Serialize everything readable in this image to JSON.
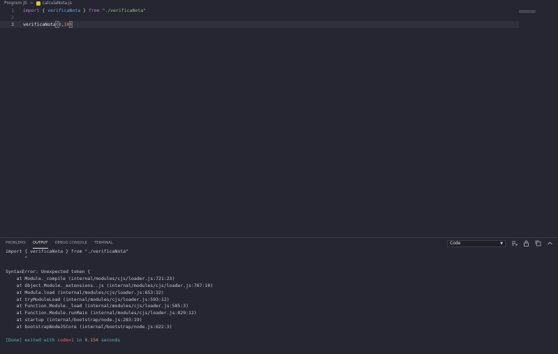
{
  "breadcrumb": {
    "folder": "Program JS",
    "separator": ">",
    "file": "calculaNota.js"
  },
  "editor": {
    "lines": [
      {
        "number": "1",
        "tokens": [
          {
            "cls": "kw",
            "text": "import"
          },
          {
            "cls": "pun",
            "text": " { "
          },
          {
            "cls": "var",
            "text": "verificaNota"
          },
          {
            "cls": "pun",
            "text": " } "
          },
          {
            "cls": "kw",
            "text": "from"
          },
          {
            "cls": "pun",
            "text": " "
          },
          {
            "cls": "str",
            "text": "\"./verificaNota\""
          }
        ]
      },
      {
        "number": "2",
        "tokens": []
      },
      {
        "number": "3",
        "tokens": [
          {
            "cls": "fn",
            "text": "verificaNota"
          },
          {
            "cls": "brk",
            "text": "("
          },
          {
            "cls": "num",
            "text": "8"
          },
          {
            "cls": "pun",
            "text": ","
          },
          {
            "cls": "num",
            "text": "10"
          },
          {
            "cls": "brk",
            "text": ")"
          }
        ]
      }
    ]
  },
  "panel": {
    "tabs": [
      "PROBLEMS",
      "OUTPUT",
      "DEBUG CONSOLE",
      "TERMINAL"
    ],
    "active_tab": "OUTPUT",
    "dropdown_value": "Code",
    "icons": [
      "clear-output-icon",
      "lock-icon",
      "copy-icon",
      "close-panel-icon"
    ],
    "output_lines": [
      "import { verificaNota } from \"./verificaNota\"",
      "       ^",
      "",
      "SyntaxError: Unexpected token {",
      "    at Module._compile (internal/modules/cjs/loader.js:721:23)",
      "    at Object.Module._extensions..js (internal/modules/cjs/loader.js:787:10)",
      "    at Module.load (internal/modules/cjs/loader.js:653:32)",
      "    at tryModuleLoad (internal/modules/cjs/loader.js:593:12)",
      "    at Function.Module._load (internal/modules/cjs/loader.js:585:3)",
      "    at Function.Module.runMain (internal/modules/cjs/loader.js:829:12)",
      "    at startup (internal/bootstrap/node.js:283:19)",
      "    at bootstrapNodeJSCore (internal/bootstrap/node.js:622:3)",
      ""
    ],
    "done": {
      "tag": "[Done]",
      "text1": " exited with ",
      "code": "code=1",
      "text2": " in ",
      "seconds": "0.154",
      "text3": " seconds"
    }
  },
  "colors": {
    "background": "#252631",
    "keyword": "#c678dd",
    "variable": "#61afef",
    "string": "#98c379",
    "number": "#d19a66",
    "done": "#56b6c2",
    "error_code": "#e06c75"
  }
}
